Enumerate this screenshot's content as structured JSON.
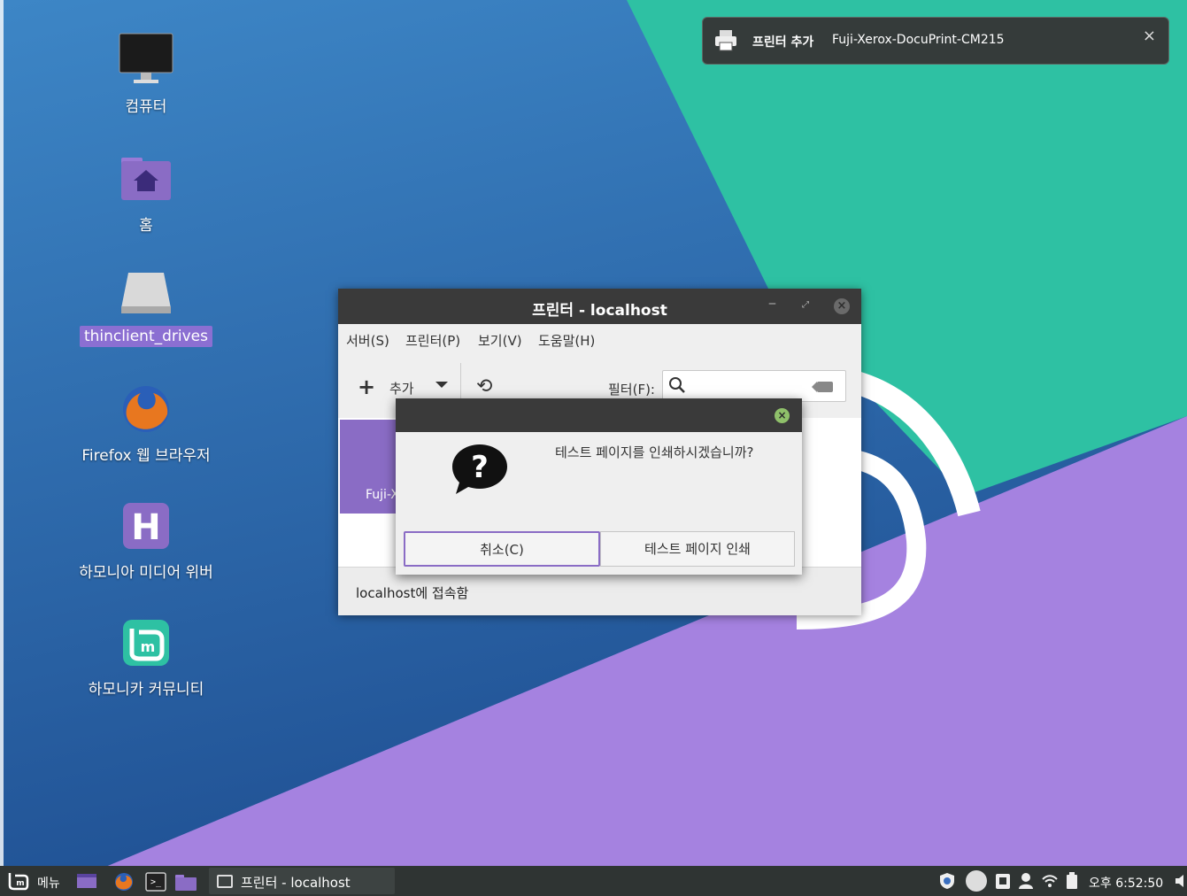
{
  "desktop": {
    "icons": [
      {
        "label": "컴퓨터",
        "icon": "monitor-icon"
      },
      {
        "label": "홈",
        "icon": "home-folder-icon"
      },
      {
        "label": "thinclient_drives",
        "icon": "drive-icon"
      },
      {
        "label": "Firefox 웹 브라우저",
        "icon": "firefox-icon"
      },
      {
        "label": "하모니아 미디어 위버",
        "icon": "media-weaver-icon"
      },
      {
        "label": "하모니카 커뮤니티",
        "icon": "community-icon"
      }
    ]
  },
  "notification": {
    "title": "프린터 추가",
    "body": "Fuji-Xerox-DocuPrint-CM215",
    "close_label": "×",
    "icon": "printer-icon"
  },
  "printer_window": {
    "title": "프린터 - localhost",
    "menu": [
      "서버(S)",
      "프린터(P)",
      "보기(V)",
      "도움말(H)"
    ],
    "toolbar": {
      "add_label": "추가",
      "filter_label": "필터(F):",
      "filter_value": ""
    },
    "printer_tile_label": "Fuji-X",
    "status": "localhost에 접속함"
  },
  "dialog": {
    "message": "테스트 페이지를 인쇄하시겠습니까?",
    "cancel_label": "취소(C)",
    "print_label": "테스트 페이지 인쇄",
    "icon": "question-icon"
  },
  "taskbar": {
    "menu_label": "메뉴",
    "window_label": "프린터 - localhost",
    "clock": "오후 6:52:50"
  },
  "colors": {
    "accent": "#8a6cc5",
    "titlebar": "#3a3a3a",
    "wallpaper_blue": "#3b7cb8",
    "wallpaper_teal": "#2ec1a3",
    "wallpaper_purple": "#a582e0"
  }
}
